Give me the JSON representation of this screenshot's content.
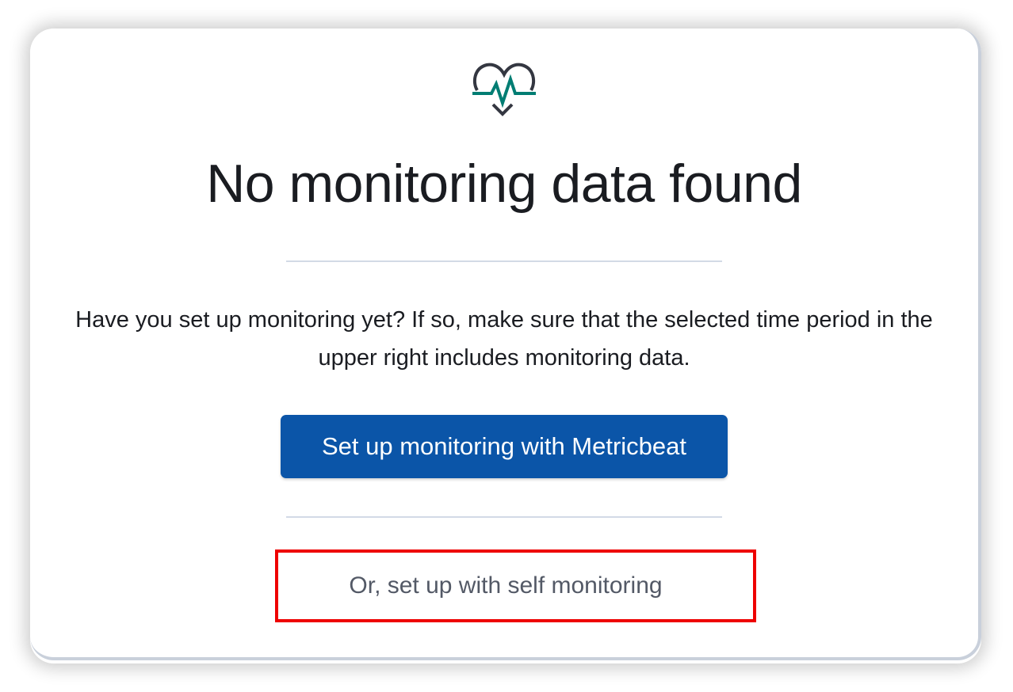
{
  "empty_state": {
    "icon": "heart-pulse-icon",
    "title": "No monitoring data found",
    "description": "Have you set up monitoring yet? If so, make sure that the selected time period in the upper right includes monitoring data.",
    "primary_button_label": "Set up monitoring with Metricbeat",
    "secondary_link_label": "Or, set up with self monitoring"
  },
  "colors": {
    "primary_button": "#0b55a8",
    "icon_pulse": "#017d73",
    "icon_outline": "#343741",
    "highlight_box": "#ee0000"
  }
}
